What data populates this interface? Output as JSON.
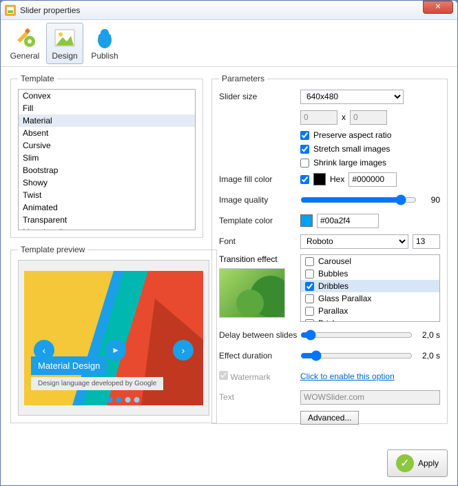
{
  "window": {
    "title": "Slider properties"
  },
  "toolbar": {
    "general": "General",
    "design": "Design",
    "publish": "Publish"
  },
  "template": {
    "legend": "Template",
    "items": [
      "Convex",
      "Fill",
      "Material",
      "Absent",
      "Cursive",
      "Slim",
      "Bootstrap",
      "Showy",
      "Twist",
      "Animated",
      "Transparent",
      "Megalopolis"
    ],
    "selected": "Material",
    "preview_legend": "Template preview",
    "preview_title": "Material Design",
    "preview_subtitle": "Design language developed by Google"
  },
  "params": {
    "legend": "Parameters",
    "slider_size_label": "Slider size",
    "slider_size_value": "640x480",
    "width": "0",
    "height": "0",
    "x": "x",
    "preserve_label": "Preserve aspect ratio",
    "preserve_checked": true,
    "stretch_label": "Stretch small images",
    "stretch_checked": true,
    "shrink_label": "Shrink large images",
    "shrink_checked": false,
    "fill_label": "Image fill color",
    "fill_checked": true,
    "hex_label": "Hex",
    "fill_hex": "#000000",
    "quality_label": "Image quality",
    "quality_value": "90",
    "tplcolor_label": "Template color",
    "tplcolor_hex": "#00a2f4",
    "font_label": "Font",
    "font_value": "Roboto",
    "font_size": "13",
    "trans_label": "Transition effect",
    "trans_items": [
      {
        "label": "Carousel",
        "checked": false
      },
      {
        "label": "Bubbles",
        "checked": false
      },
      {
        "label": "Dribbles",
        "checked": true
      },
      {
        "label": "Glass Parallax",
        "checked": false
      },
      {
        "label": "Parallax",
        "checked": false
      },
      {
        "label": "Brick",
        "checked": false
      }
    ],
    "delay_label": "Delay between slides",
    "delay_value": "2,0 s",
    "duration_label": "Effect duration",
    "duration_value": "2,0 s",
    "watermark_label": "Watermark",
    "watermark_link": "Click to enable this option",
    "text_label": "Text",
    "text_value": "WOWSlider.com",
    "advanced_label": "Advanced..."
  },
  "footer": {
    "apply": "Apply"
  }
}
